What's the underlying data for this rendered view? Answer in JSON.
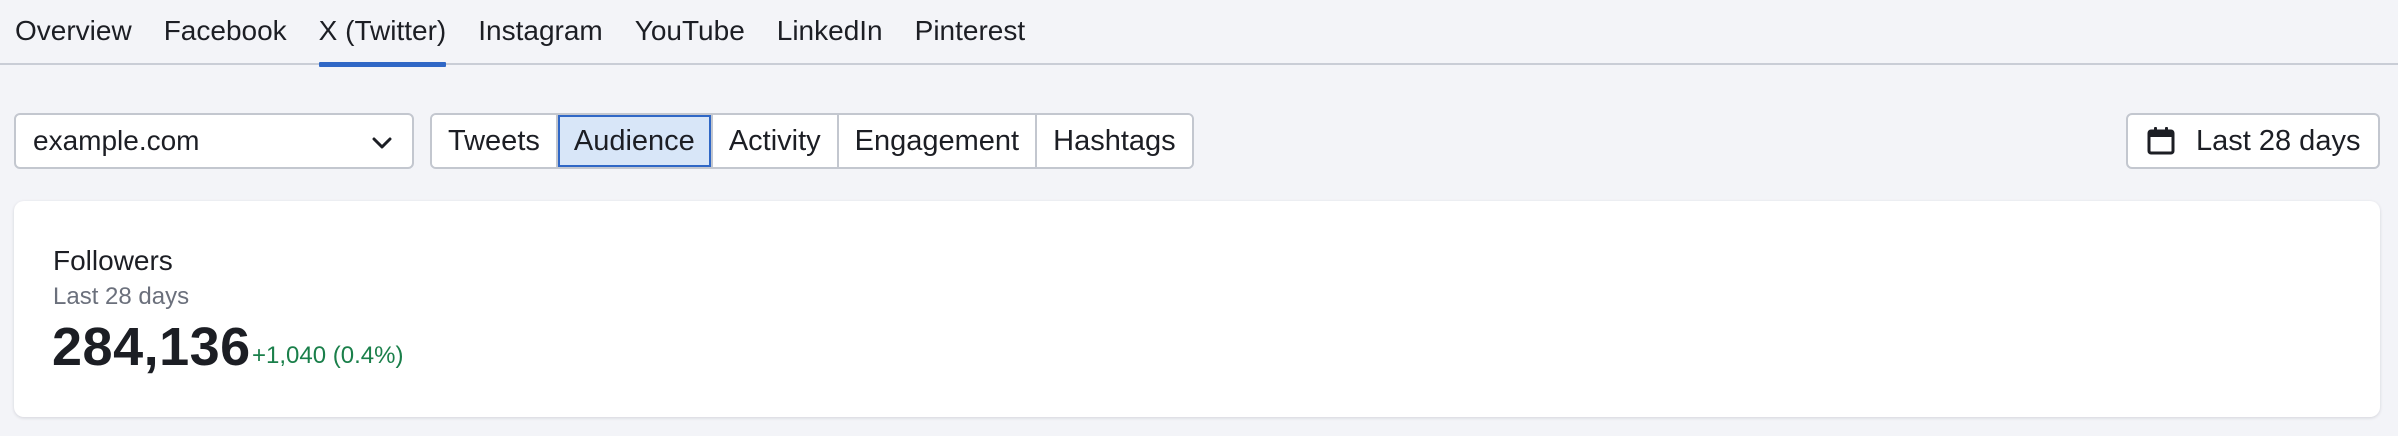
{
  "tabs": [
    {
      "label": "Overview",
      "active": false
    },
    {
      "label": "Facebook",
      "active": false
    },
    {
      "label": "X (Twitter)",
      "active": true
    },
    {
      "label": "Instagram",
      "active": false
    },
    {
      "label": "YouTube",
      "active": false
    },
    {
      "label": "LinkedIn",
      "active": false
    },
    {
      "label": "Pinterest",
      "active": false
    }
  ],
  "domain_select": {
    "value": "example.com",
    "icon": "chevron-down-icon"
  },
  "view_segments": [
    {
      "label": "Tweets",
      "selected": false
    },
    {
      "label": "Audience",
      "selected": true
    },
    {
      "label": "Activity",
      "selected": false
    },
    {
      "label": "Engagement",
      "selected": false
    },
    {
      "label": "Hashtags",
      "selected": false
    }
  ],
  "date_range": {
    "label": "Last 28 days",
    "icon": "calendar-icon"
  },
  "followers_card": {
    "title": "Followers",
    "period": "Last 28 days",
    "value": "284,136",
    "delta": "+1,040 (0.4%)"
  },
  "colors": {
    "accent": "#2f67c6",
    "selected_bg": "#d8e6f8",
    "positive": "#1a7f4a",
    "page_bg": "#f3f4f8"
  }
}
